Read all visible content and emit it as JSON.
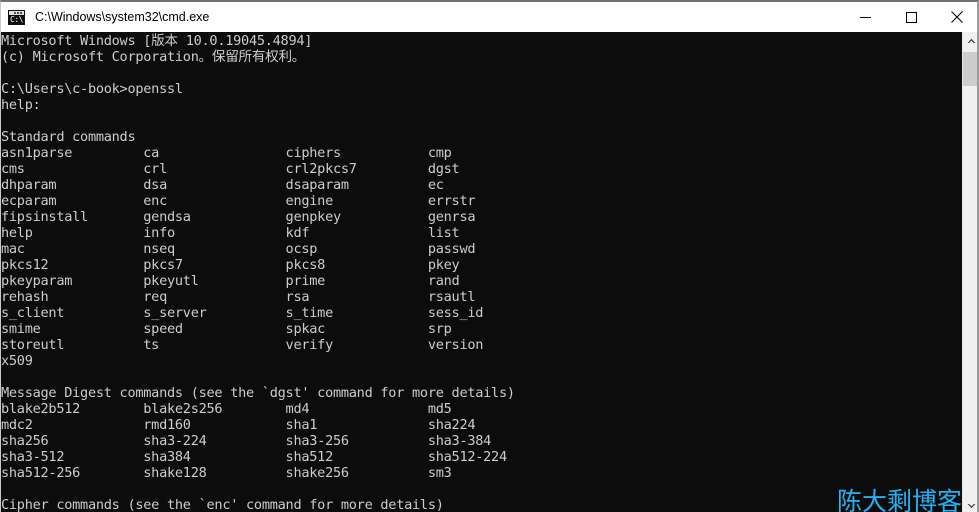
{
  "window": {
    "title": "C:\\Windows\\system32\\cmd.exe",
    "icon": "cmd-console-icon",
    "icon_glyph": "C:\\.",
    "background_color": "#0c0c0c",
    "foreground_color": "#cccccc",
    "titlebar_color": "#ffffff"
  },
  "titlebar": {
    "minimize_label": "Minimize",
    "maximize_label": "Maximize",
    "close_label": "Close"
  },
  "console": {
    "lines": [
      "Microsoft Windows [版本 10.0.19045.4894]",
      "(c) Microsoft Corporation。保留所有权利。",
      "",
      "C:\\Users\\c-book>openssl",
      "help:",
      "",
      "Standard commands",
      "asn1parse         ca                ciphers           cmp",
      "cms               crl               crl2pkcs7         dgst",
      "dhparam           dsa               dsaparam          ec",
      "ecparam           enc               engine            errstr",
      "fipsinstall       gendsa            genpkey           genrsa",
      "help              info              kdf               list",
      "mac               nseq              ocsp              passwd",
      "pkcs12            pkcs7             pkcs8             pkey",
      "pkeyparam         pkeyutl           prime             rand",
      "rehash            req               rsa               rsautl",
      "s_client          s_server          s_time            sess_id",
      "smime             speed             spkac             srp",
      "storeutl          ts                verify            version",
      "x509",
      "",
      "Message Digest commands (see the `dgst' command for more details)",
      "blake2b512        blake2s256        md4               md5",
      "mdc2              rmd160            sha1              sha224",
      "sha256            sha3-224          sha3-256          sha3-384",
      "sha3-512          sha384            sha512            sha512-224",
      "sha512-256        shake128          shake256          sm3",
      "",
      "Cipher commands (see the `enc' command for more details)"
    ],
    "prompt_path": "C:\\Users\\c-book>",
    "command_entered": "openssl",
    "watermark": "陈大剩博客",
    "watermark_color": "#26b0f0"
  },
  "scrollbar": {
    "up_arrow": "scroll-up-arrow",
    "down_arrow": "scroll-down-arrow",
    "thumb_label": "scroll-thumb"
  }
}
